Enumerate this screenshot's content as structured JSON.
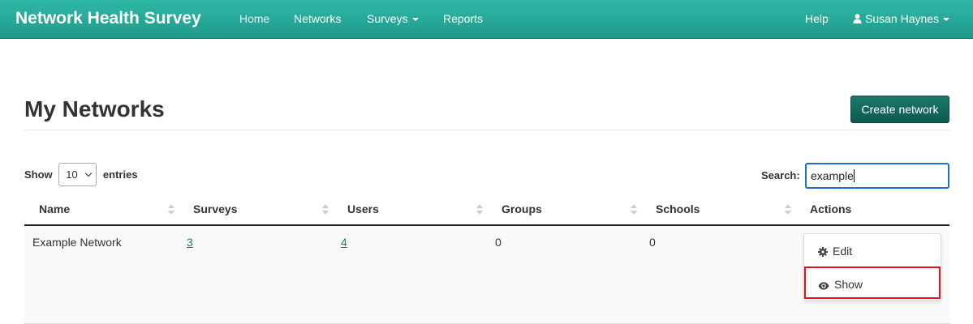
{
  "navbar": {
    "brand": "Network Health Survey",
    "items": [
      {
        "label": "Home"
      },
      {
        "label": "Networks"
      },
      {
        "label": "Surveys"
      },
      {
        "label": "Reports"
      }
    ],
    "help_label": "Help",
    "user_name": "Susan Haynes",
    "colors": {
      "bar": "#2fb8a6",
      "text": "#ffffff"
    }
  },
  "page": {
    "title": "My Networks",
    "create_button": "Create network",
    "accent_color": "#1a7a6b"
  },
  "table_controls": {
    "show_label": "Show",
    "entries_value": "10",
    "entries_label": "entries",
    "search_label": "Search:",
    "search_value": "example"
  },
  "table": {
    "columns": [
      "Name",
      "Surveys",
      "Users",
      "Groups",
      "Schools",
      "Actions"
    ],
    "rows": [
      {
        "name": "Example Network",
        "surveys": "3",
        "users": "4",
        "groups": "0",
        "schools": "0"
      }
    ]
  },
  "actions_menu": {
    "items": [
      {
        "label": "Edit",
        "icon": "gear-icon"
      },
      {
        "label": "Show",
        "icon": "eye-icon",
        "highlighted": true
      }
    ],
    "highlight_color": "#e8121c"
  }
}
